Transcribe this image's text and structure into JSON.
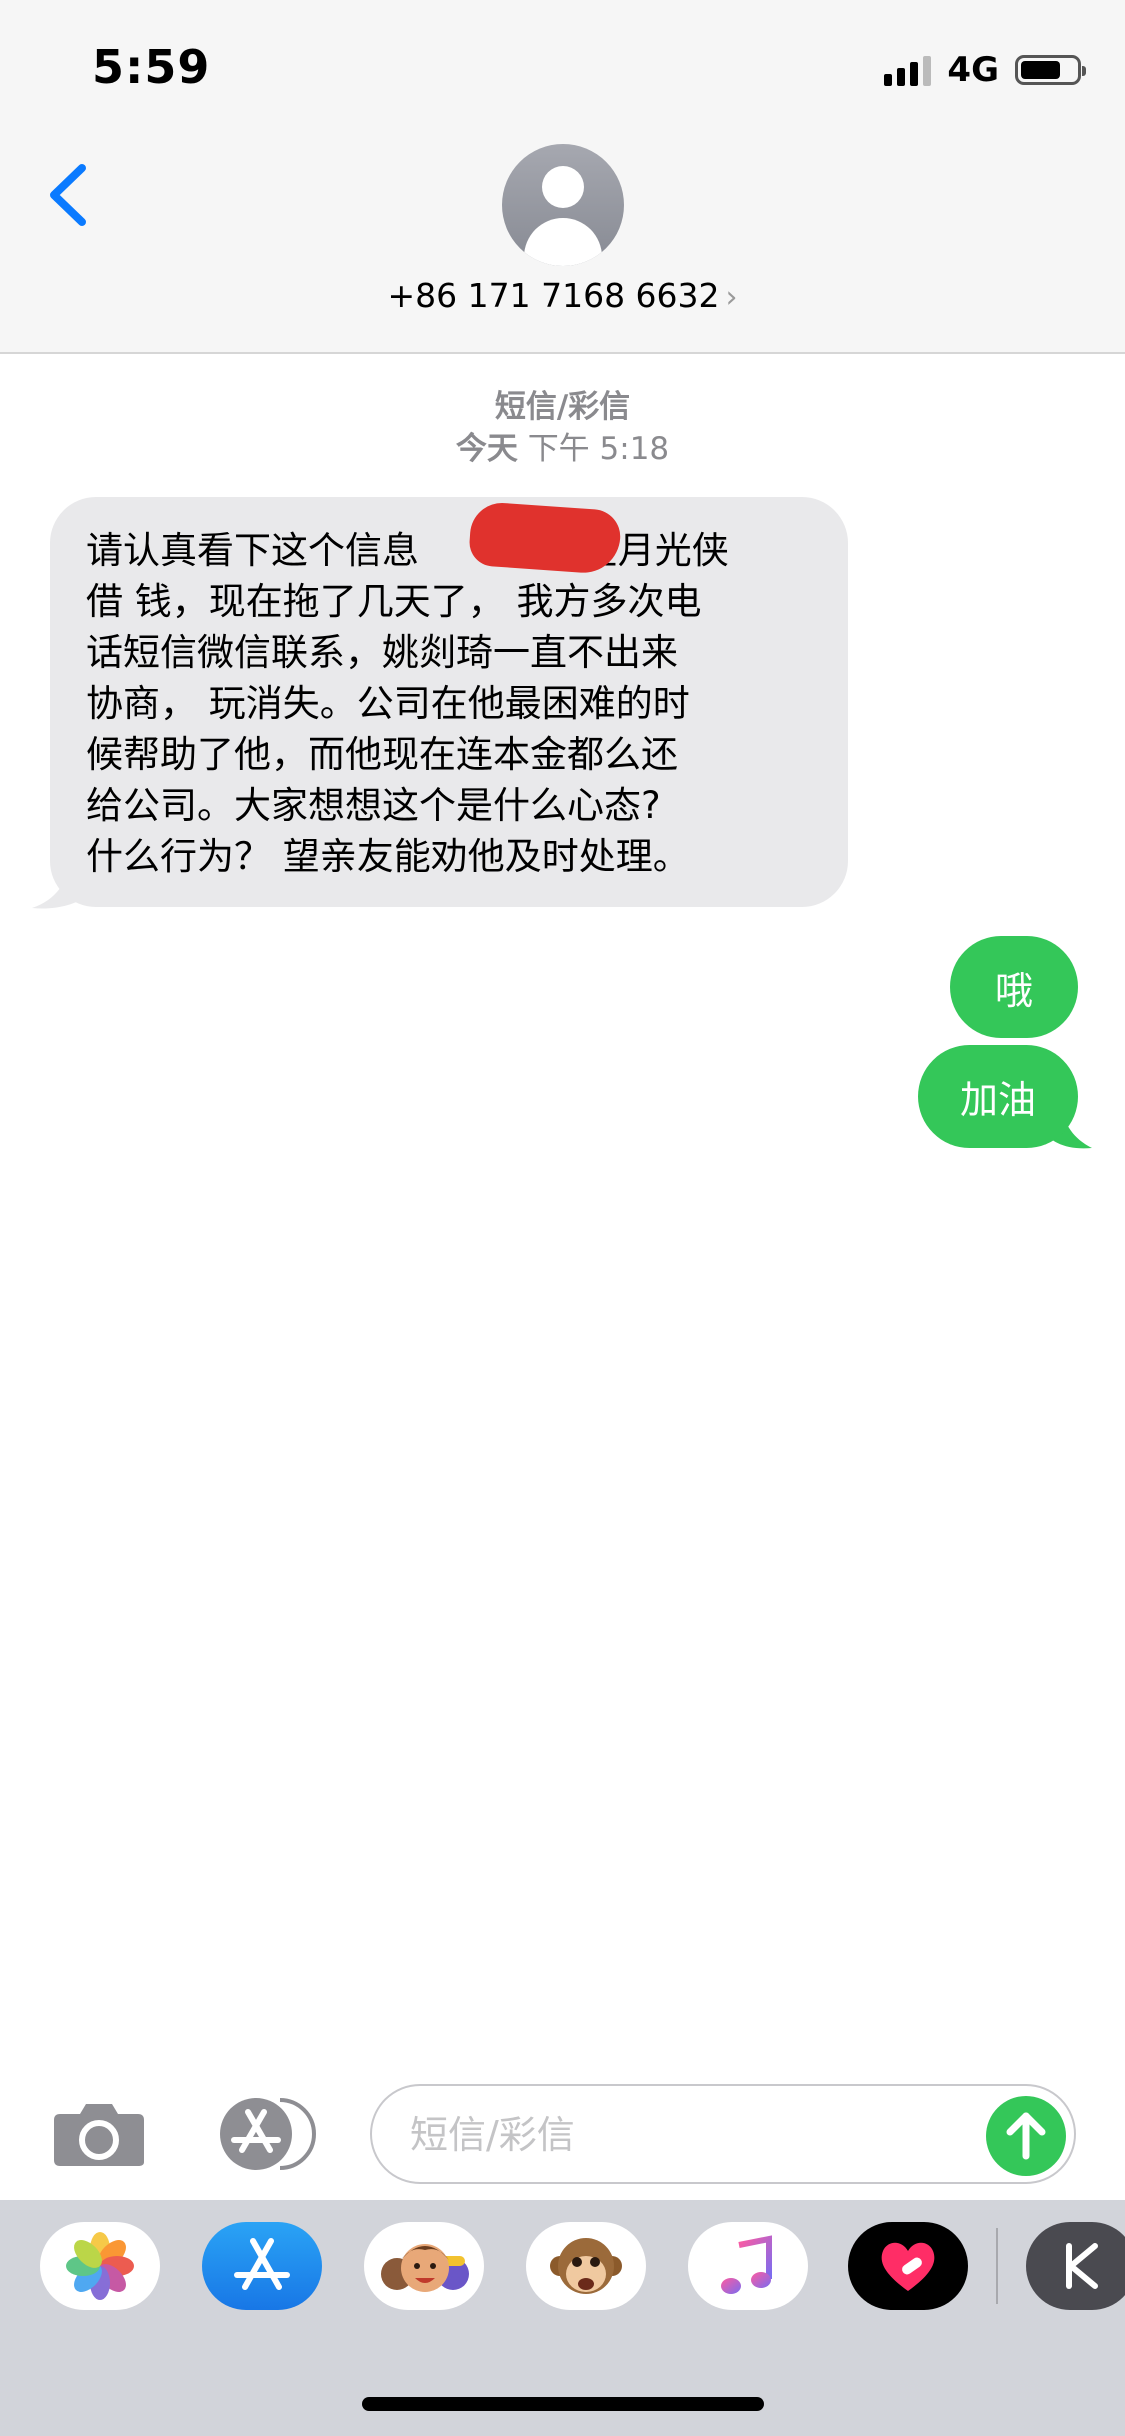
{
  "status_bar": {
    "time": "5:59",
    "network": "4G",
    "battery_level": 0.72
  },
  "header": {
    "contact": "+86 171 7168 6632",
    "chevron": "›"
  },
  "conversation": {
    "message_type": "短信/彩信",
    "timestamp_day": "今天",
    "timestamp_time": "下午 5:18",
    "incoming": {
      "lines": [
        "请认真看下这个信息",
        "借 钱，现在拖了几天了， 我方多次电",
        "话短信微信联系，姚剡琦一直不出来",
        "协商， 玩消失。公司在他最困难的时",
        "候帮助了他，而他现在连本金都么还",
        "给公司。大家想想这个是什么心态?",
        "什么行为？ 望亲友能劝他及时处理。"
      ],
      "line1_tail": ",在月光侠"
    },
    "outgoing": [
      "哦",
      "加油"
    ]
  },
  "composer": {
    "placeholder": "短信/彩信"
  },
  "colors": {
    "accent_blue": "#0a7aff",
    "imessage_green": "#34c759",
    "bubble_gray": "#e9e9eb",
    "redaction_red": "#e0322d"
  },
  "icons": [
    "back-chevron-icon",
    "avatar-icon",
    "camera-icon",
    "app-store-icon",
    "send-arrow-icon",
    "photos-icon",
    "memoji-icon",
    "animoji-monkey-icon",
    "music-icon",
    "heart-app-icon",
    "k-app-icon"
  ]
}
